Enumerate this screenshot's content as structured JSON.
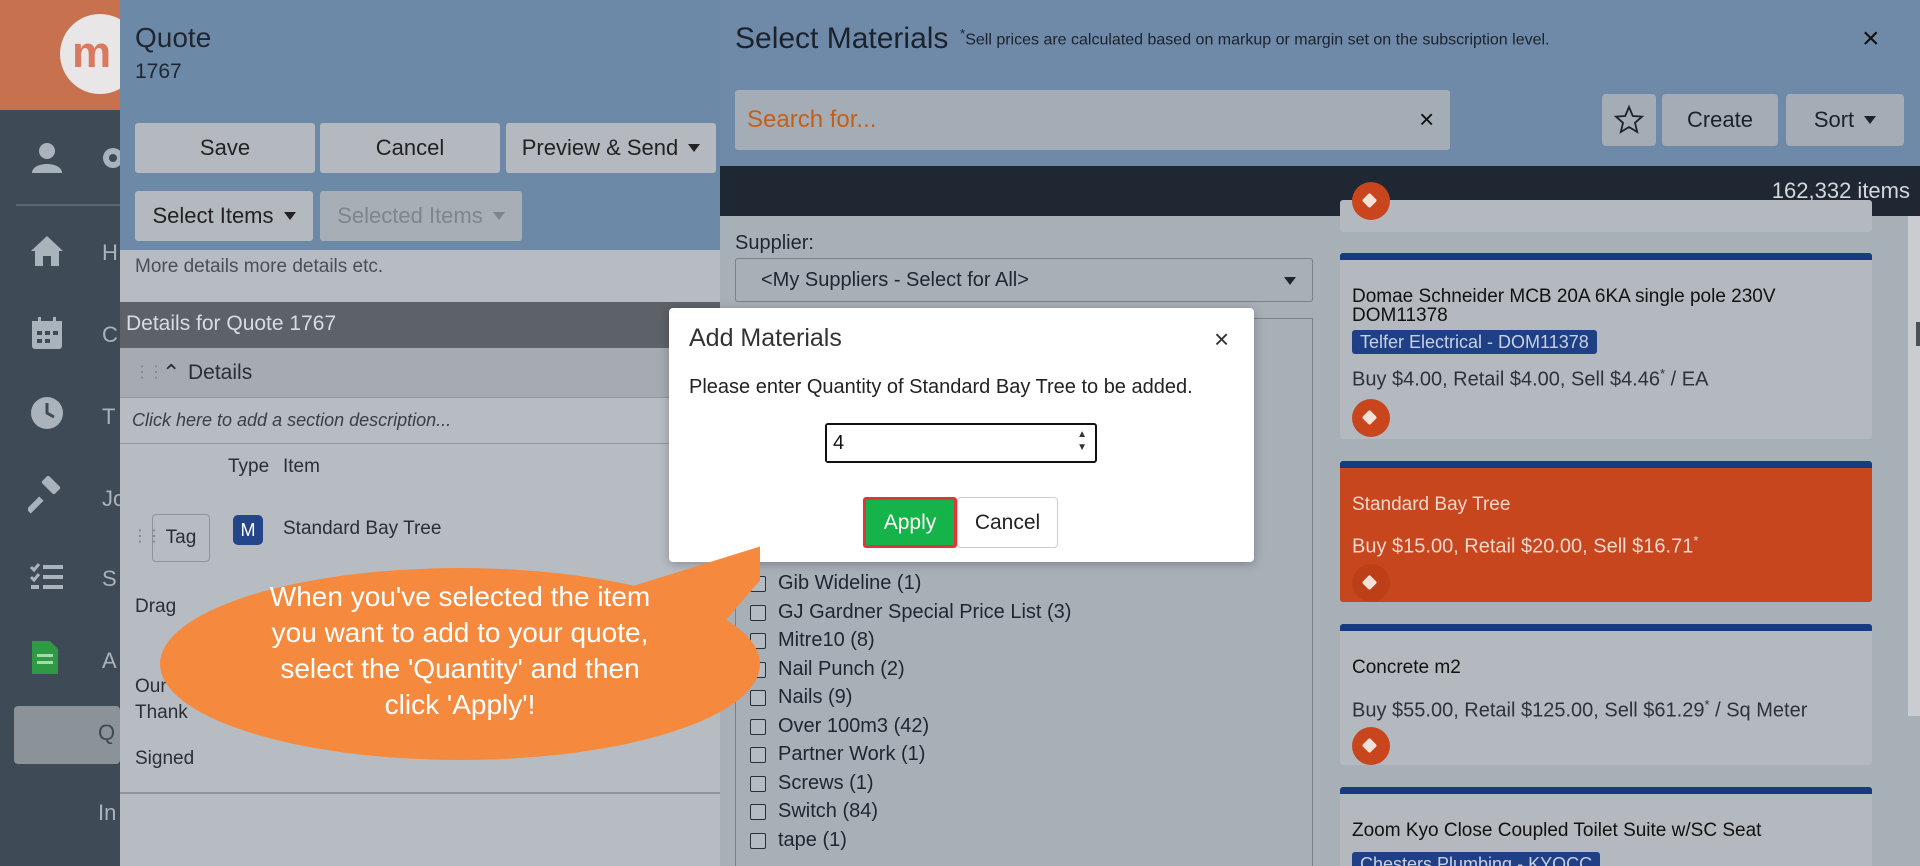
{
  "sidebar": {
    "logo_text": "m",
    "items": [
      {
        "icon": "home-icon",
        "label": "H"
      },
      {
        "icon": "calendar-icon",
        "label": "C"
      },
      {
        "icon": "clock-icon",
        "label": "T"
      },
      {
        "icon": "hammer-icon",
        "label": "Jo"
      },
      {
        "icon": "list-icon",
        "label": "S"
      },
      {
        "icon": "document-icon",
        "label": "A"
      },
      {
        "icon": "",
        "label": "Q"
      },
      {
        "icon": "",
        "label": "In"
      }
    ]
  },
  "quote": {
    "title": "Quote",
    "number": "1767",
    "toolbar": {
      "save": "Save",
      "cancel": "Cancel",
      "preview_send": "Preview & Send",
      "select_items": "Select Items",
      "selected_items": "Selected Items"
    },
    "more_details": "More details more details etc.",
    "details_header": "Details for Quote 1767",
    "section_label": "Details",
    "section_description": "Click here to add a section description...",
    "columns": {
      "type": "Type",
      "item": "Item"
    },
    "line_item": {
      "tag": "Tag",
      "badge": "M",
      "name": "Standard Bay Tree"
    },
    "drag_text": "Drag",
    "our_text_1": "Our",
    "our_text_2": "Thank",
    "signed": "Signed"
  },
  "materials": {
    "title": "Select Materials",
    "note_star": "*",
    "note": "Sell prices are calculated based on markup or margin set on the subscription level.",
    "close": "×",
    "search": {
      "placeholder": "Search for...",
      "clear": "×"
    },
    "buttons": {
      "create": "Create",
      "sort": "Sort"
    },
    "item_count": "162,332 items",
    "supplier": {
      "label": "Supplier:",
      "selected": "<My Suppliers - Select for All>"
    },
    "filters": [
      {
        "label": "Gib Wideline (1)"
      },
      {
        "label": "GJ Gardner Special Price List (3)"
      },
      {
        "label": "Mitre10 (8)"
      },
      {
        "label": "Nail Punch (2)"
      },
      {
        "label": "Nails (9)"
      },
      {
        "label": "Over 100m3 (42)"
      },
      {
        "label": "Partner Work (1)"
      },
      {
        "label": "Screws (1)"
      },
      {
        "label": "Switch (84)"
      },
      {
        "label": "tape (1)"
      }
    ],
    "cards": [
      {
        "name": "Domae Schneider MCB 20A 6KA single pole 230V DOM11378",
        "supplier": "Telfer Electrical - DOM11378",
        "price": "Buy $4.00, Retail $4.00, Sell $4.46",
        "unit": " / EA"
      },
      {
        "name": "Standard Bay Tree",
        "supplier": "",
        "price": "Buy $15.00, Retail $20.00, Sell $16.71",
        "unit": ""
      },
      {
        "name": "Concrete m2",
        "supplier": "",
        "price": "Buy $55.00, Retail $125.00, Sell $61.29",
        "unit": " / Sq Meter"
      },
      {
        "name": "Zoom Kyo Close Coupled Toilet Suite w/SC Seat",
        "supplier": "Chesters Plumbing - KYOCC",
        "price": "",
        "unit": ""
      }
    ]
  },
  "modal": {
    "title": "Add Materials",
    "close": "×",
    "message": "Please enter Quantity of Standard Bay Tree to be added.",
    "quantity": "4",
    "apply": "Apply",
    "cancel": "Cancel"
  },
  "callout": {
    "lines": [
      "When you've selected the item",
      "you want to add to your quote,",
      "select the 'Quantity' and then",
      "click 'Apply'!"
    ]
  },
  "colors": {
    "accent_orange": "#c7461d",
    "apply_green": "#16b24a",
    "callout_orange": "#f58a3e",
    "navy": "#173b82"
  }
}
